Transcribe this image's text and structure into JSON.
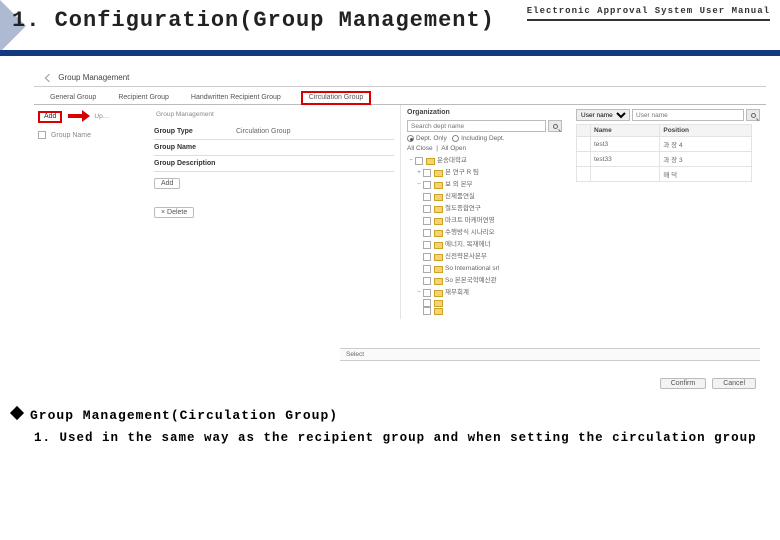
{
  "header": {
    "title": "1. Configuration(Group Management)",
    "subtitle": "Electronic Approval System User Manual"
  },
  "panel": {
    "title": "Group Management",
    "tabs": [
      "General Group",
      "Recipient Group",
      "Handwritten Recipient Group",
      "Circulation Group"
    ],
    "leftcol": {
      "add_label": "Add",
      "upper_label": "Up…",
      "list_header": "Group Name",
      "mid_top": "Group Management"
    },
    "form": {
      "type_label": "Group Type",
      "type_value": "Circulation Group",
      "name_label": "Group Name",
      "desc_label": "Group Description",
      "add_btn": "Add",
      "delete_btn": "× Delete"
    },
    "org": {
      "title": "Organization",
      "search_placeholder": "Search dept name",
      "radio1": "Dept. Only",
      "radio2": "Including Dept.",
      "all_close": "All Close",
      "all_open": "All Open",
      "tree": [
        "운송대학교",
        "본 연구 R 팀",
        "보 외 본부",
        "신제품연실",
        "철도종합연구",
        "마크트 마케머연영",
        "수행방식 시나리오",
        "에너지, 목재에너",
        "신전략본사본부",
        "So International srl",
        "So 본본국학예산관",
        "재무회계",
        "",
        ""
      ]
    },
    "users": {
      "dropdown": "User name",
      "search_placeholder": "User name",
      "col1": "Name",
      "col2": "Position",
      "rows": [
        {
          "name": "test3",
          "position": "과 장 4"
        },
        {
          "name": "test33",
          "position": "과 장 3"
        },
        {
          "name": "",
          "position": "매 덕"
        }
      ]
    },
    "select_label": "Select",
    "confirm": "Confirm",
    "cancel": "Cancel"
  },
  "notes": {
    "heading": "Group Management(Circulation Group)",
    "item1_prefix": "1.",
    "item1": "Used in the same way as the recipient group and when setting the circulation group"
  }
}
